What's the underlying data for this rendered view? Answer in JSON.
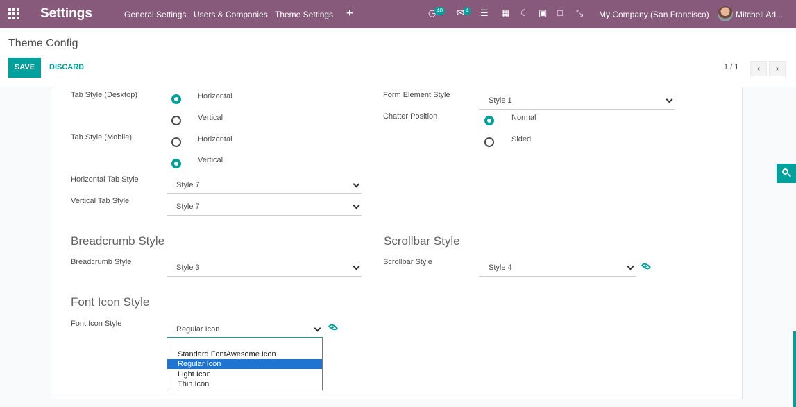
{
  "navbar": {
    "brand": "Settings",
    "menu": [
      "General Settings",
      "Users & Companies",
      "Theme Settings"
    ],
    "plus": "+",
    "activity_badge": "40",
    "messages_badge": "4",
    "company": "My Company (San Francisco)",
    "user": "Mitchell Ad...",
    "color": "#875a7b"
  },
  "control": {
    "title": "Theme Config",
    "save": "SAVE",
    "discard": "DISCARD",
    "pager": "1 / 1",
    "accent": "#00a09d"
  },
  "form": {
    "tab_desktop_label": "Tab Style (Desktop)",
    "tab_desktop_opts": [
      "Horizontal",
      "Vertical"
    ],
    "tab_desktop_selected": "Horizontal",
    "tab_mobile_label": "Tab Style (Mobile)",
    "tab_mobile_opts": [
      "Horizontal",
      "Vertical"
    ],
    "tab_mobile_selected": "Vertical",
    "horizontal_tab_label": "Horizontal Tab Style",
    "horizontal_tab_value": "Style 7",
    "vertical_tab_label": "Vertical Tab Style",
    "vertical_tab_value": "Style 7",
    "form_element_label": "Form Element Style",
    "form_element_value": "Style 1",
    "chatter_label": "Chatter Position",
    "chatter_opts": [
      "Normal",
      "Sided"
    ],
    "chatter_selected": "Normal",
    "breadcrumb_section": "Breadcrumb Style",
    "breadcrumb_label": "Breadcrumb Style",
    "breadcrumb_value": "Style 3",
    "scrollbar_section": "Scrollbar Style",
    "scrollbar_label": "Scrollbar Style",
    "scrollbar_value": "Style 4",
    "fonticon_section": "Font Icon Style",
    "fonticon_label": "Font Icon Style",
    "fonticon_value": "Regular Icon"
  },
  "dropdown": {
    "options": [
      "Standard FontAwesome Icon",
      "Regular Icon",
      "Light Icon",
      "Thin Icon"
    ],
    "selected": "Regular Icon",
    "highlight": "#1e74d0"
  }
}
